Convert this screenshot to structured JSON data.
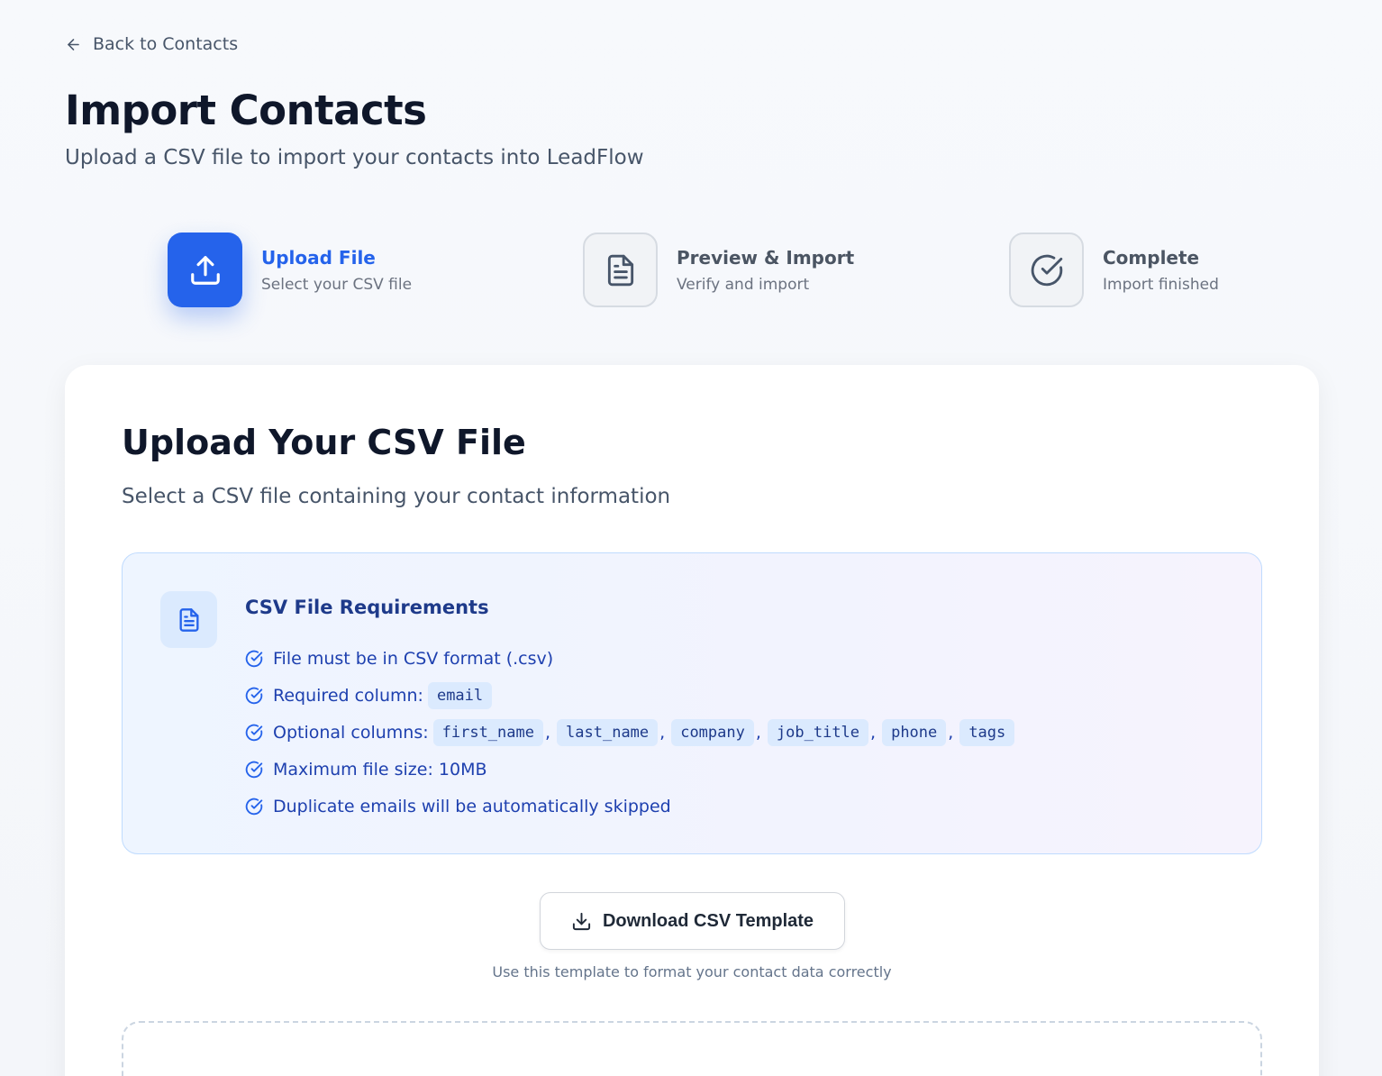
{
  "nav": {
    "back_label": "Back to Contacts"
  },
  "header": {
    "title": "Import Contacts",
    "subtitle": "Upload a CSV file to import your contacts into LeadFlow"
  },
  "steps": [
    {
      "title": "Upload File",
      "subtitle": "Select your CSV file",
      "icon": "upload-icon",
      "state": "active"
    },
    {
      "title": "Preview & Import",
      "subtitle": "Verify and import",
      "icon": "document-icon",
      "state": "pending"
    },
    {
      "title": "Complete",
      "subtitle": "Import finished",
      "icon": "check-circle-icon",
      "state": "pending"
    }
  ],
  "card": {
    "title": "Upload Your CSV File",
    "subtitle": "Select a CSV file containing your contact information"
  },
  "requirements": {
    "title": "CSV File Requirements",
    "items": {
      "format": "File must be in CSV format (.csv)",
      "required_label": "Required column:",
      "required_columns": [
        "email"
      ],
      "optional_label": "Optional columns:",
      "optional_columns": [
        "first_name",
        "last_name",
        "company",
        "job_title",
        "phone",
        "tags"
      ],
      "max_size": "Maximum file size: 10MB",
      "duplicates": "Duplicate emails will be automatically skipped"
    }
  },
  "template": {
    "button_label": "Download CSV Template",
    "hint": "Use this template to format your contact data correctly"
  },
  "colors": {
    "accent": "#2563eb",
    "requirements_text": "#1e40af",
    "background": "#f6f8fb"
  }
}
